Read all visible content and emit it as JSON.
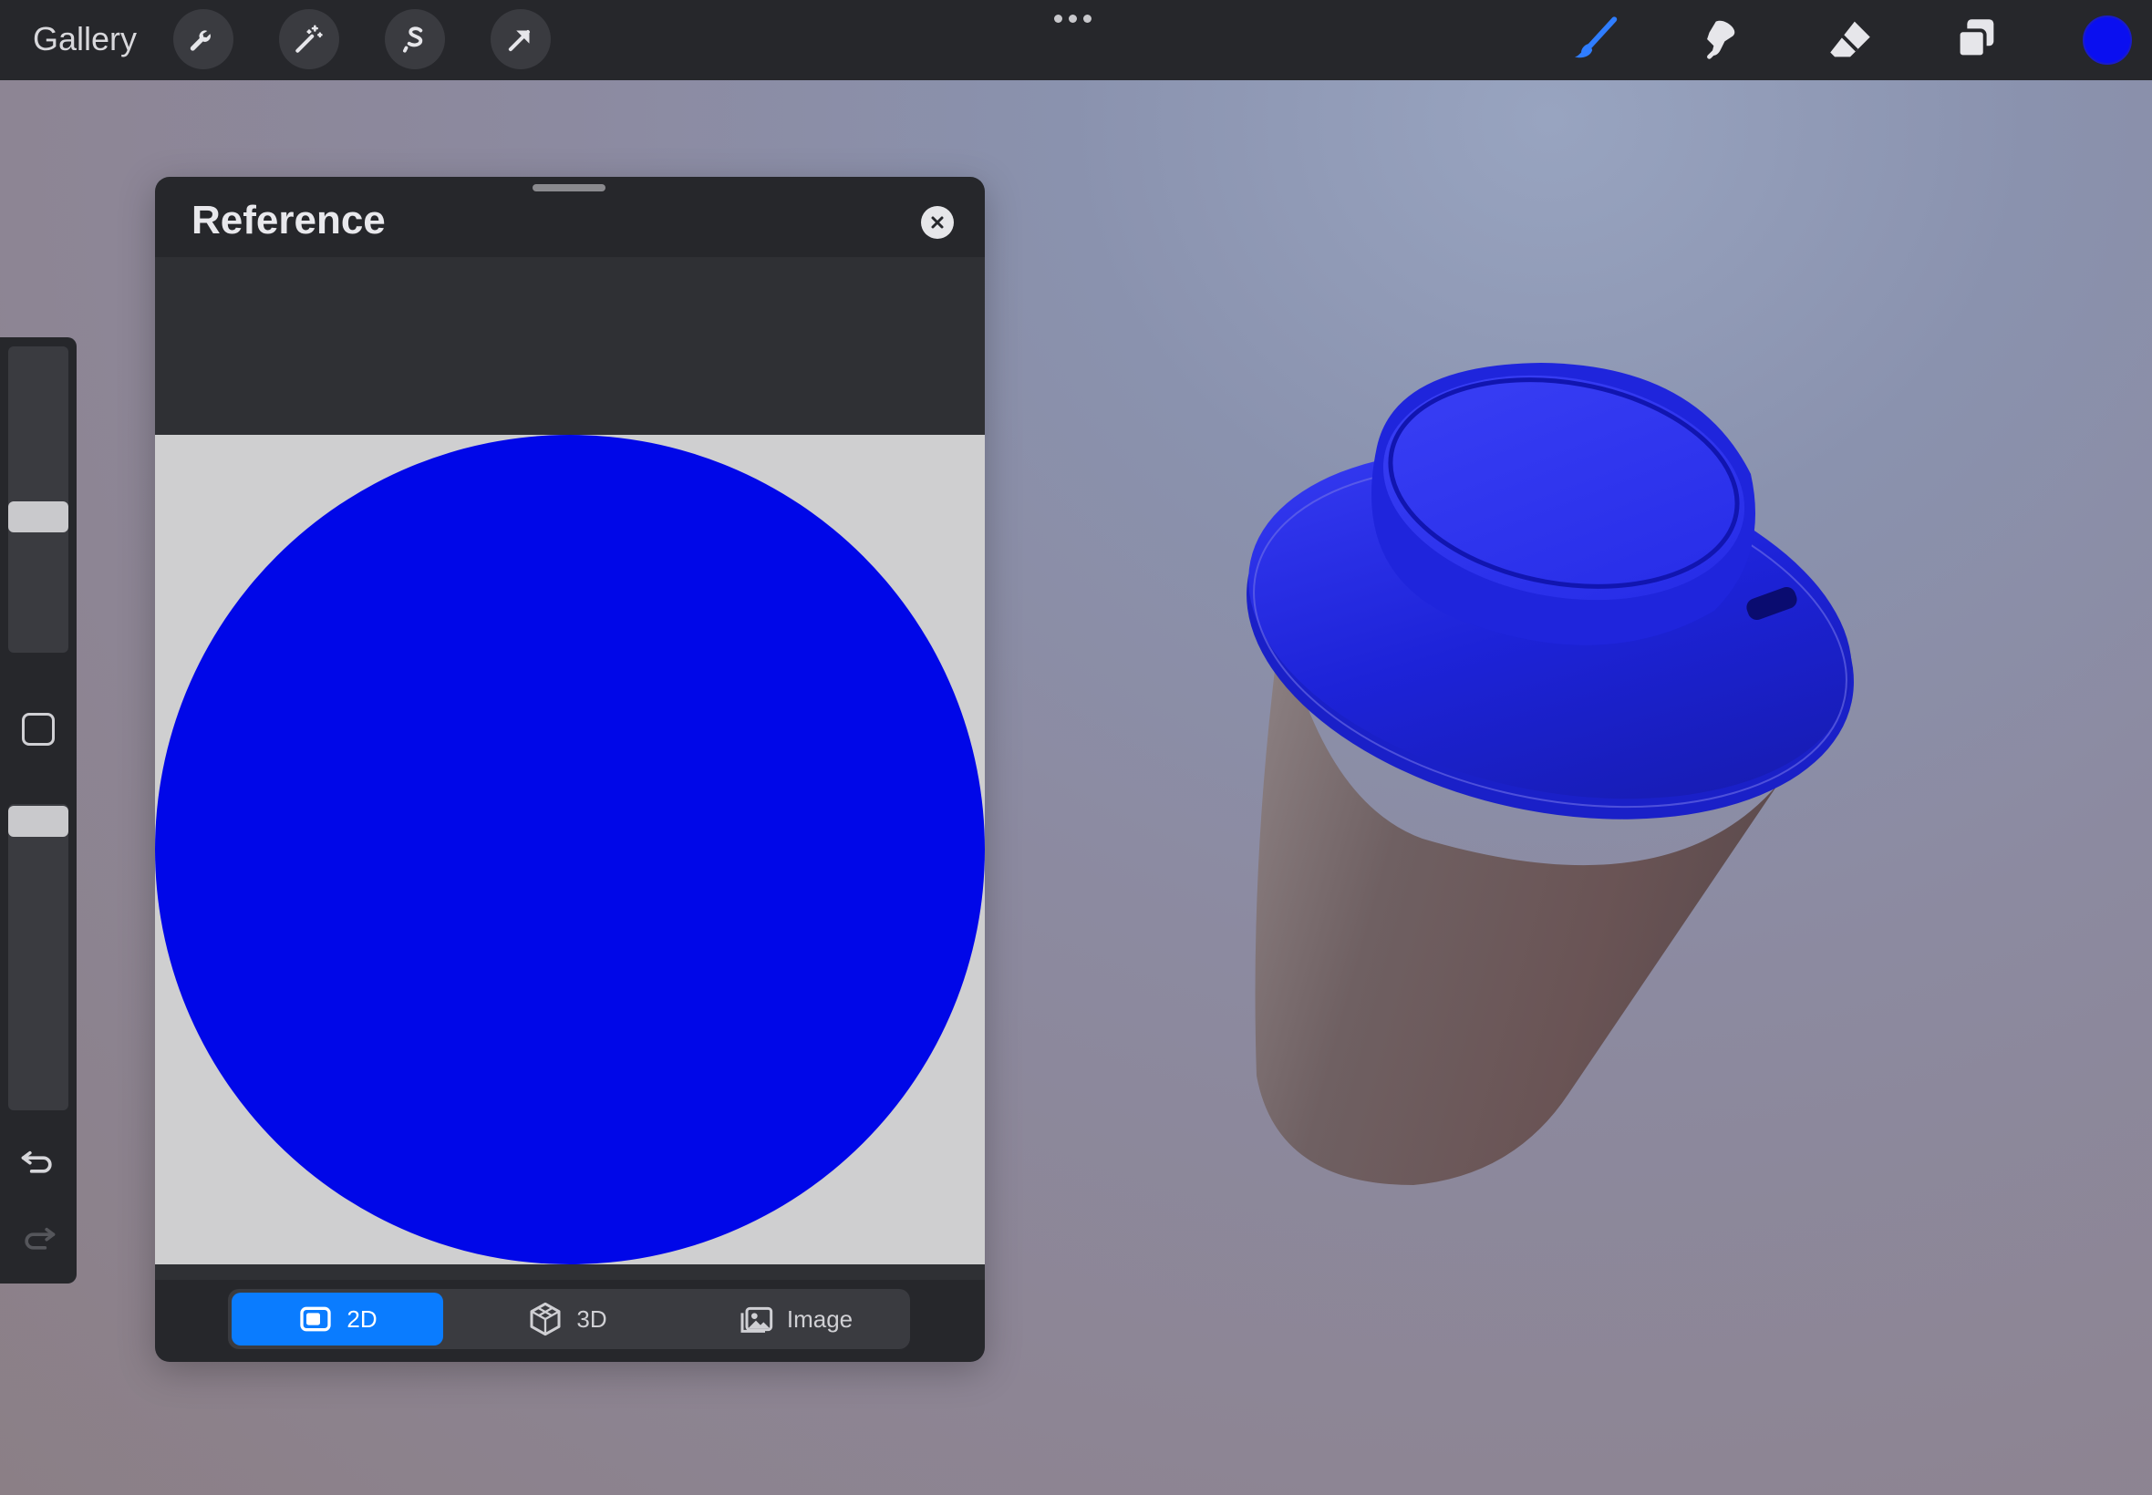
{
  "topbar": {
    "gallery_label": "Gallery",
    "left_tools": [
      "wrench-icon",
      "magic-wand-icon",
      "selection-icon",
      "transform-arrow-icon"
    ],
    "right_tools": [
      "brush-icon",
      "smudge-icon",
      "eraser-icon",
      "layers-icon"
    ],
    "current_color": "#0a0ff0"
  },
  "sidebar": {
    "brush_size_level": 0.5,
    "opacity_level": 0.0,
    "undo_icon": "undo-icon",
    "redo_icon": "redo-icon"
  },
  "reference": {
    "title": "Reference",
    "reference_fill": "#0007e8",
    "modes": {
      "twod": "2D",
      "threed": "3D",
      "image": "Image"
    },
    "active_mode": "2D"
  },
  "colors": {
    "accent": "#0a7cff",
    "lid": "#1c22d6",
    "cup_body": "#7a6566"
  }
}
